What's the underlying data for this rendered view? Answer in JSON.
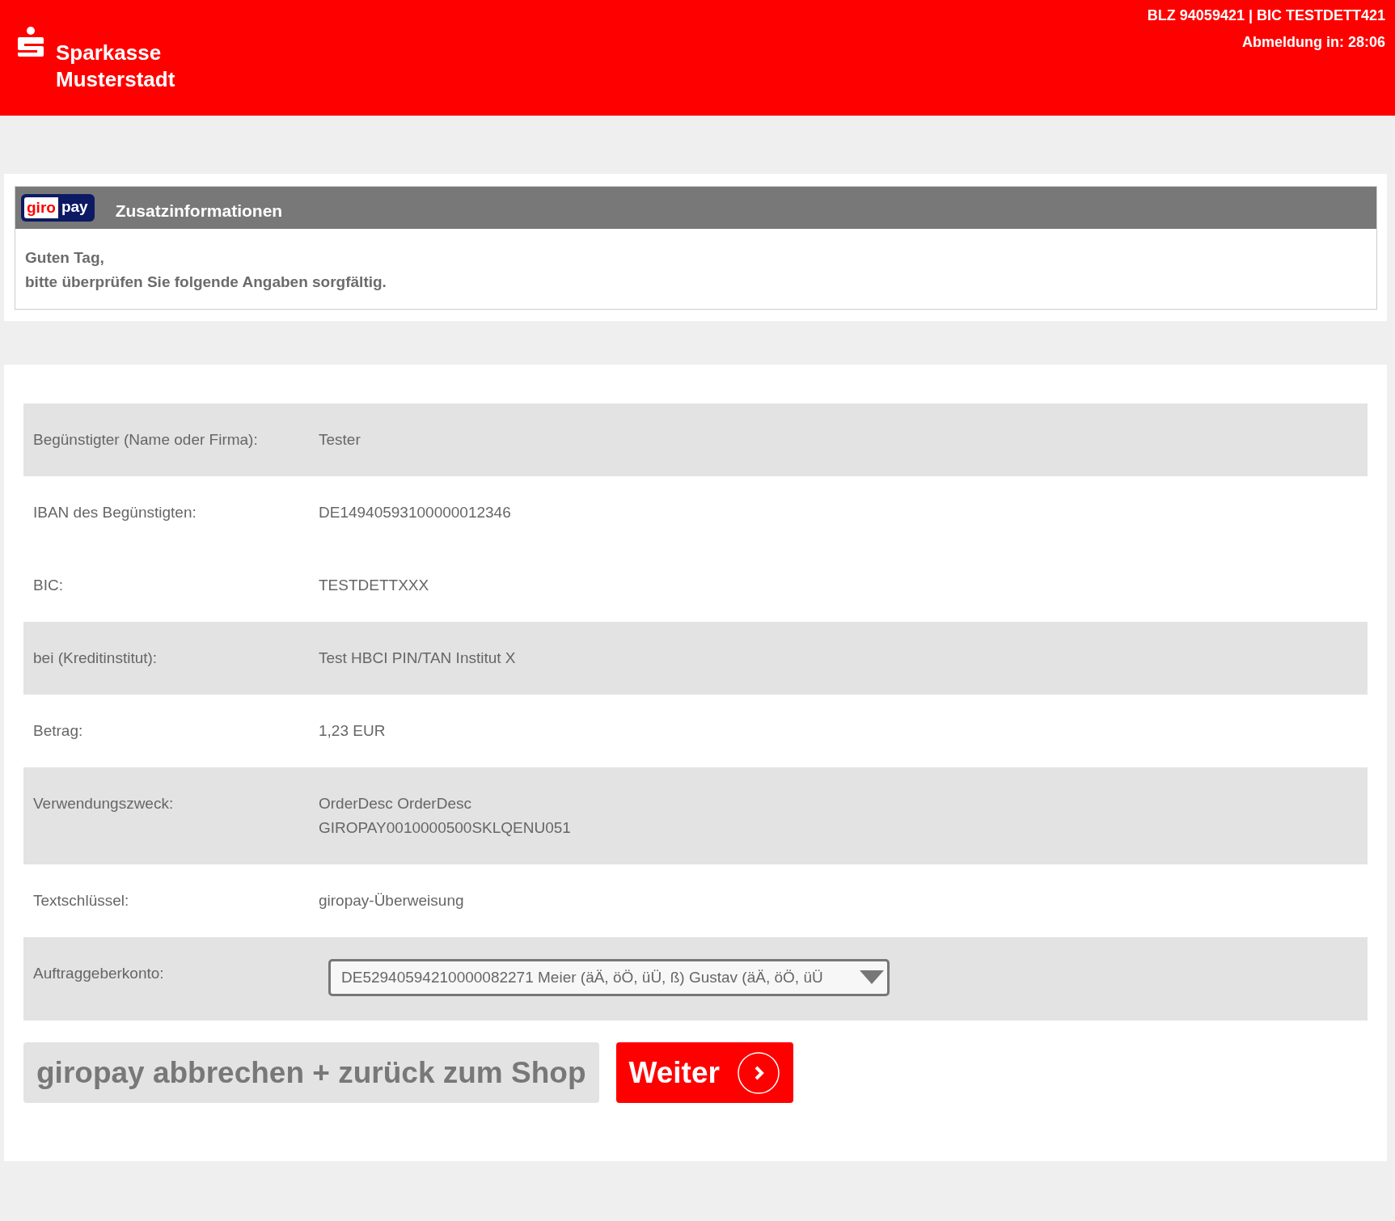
{
  "header": {
    "bank_name_lines": [
      "Sparkasse",
      "Musterstadt"
    ],
    "bank_ids": "BLZ 94059421 | BIC TESTDETT421",
    "logout_timer": "Abmeldung in: 28:06"
  },
  "info_panel": {
    "logo": {
      "part_1": "giro",
      "part_2": "pay"
    },
    "title": "Zusatzinformationen",
    "greeting_lines": [
      "Guten Tag,",
      "bitte überprüfen Sie folgende Angaben sorgfältig."
    ]
  },
  "details": [
    {
      "kind": "text",
      "shaded": true,
      "label": "Begünstigter (Name oder Firma):",
      "value_lines": [
        "Tester"
      ]
    },
    {
      "kind": "text",
      "shaded": false,
      "label": "IBAN des Begünstigten:",
      "value_lines": [
        "DE14940593100000012346"
      ]
    },
    {
      "kind": "text",
      "shaded": false,
      "label": "BIC:",
      "value_lines": [
        "TESTDETTXXX"
      ]
    },
    {
      "kind": "text",
      "shaded": true,
      "label": "bei (Kreditinstitut):",
      "value_lines": [
        "Test HBCI PIN/TAN Institut X"
      ]
    },
    {
      "kind": "text",
      "shaded": false,
      "label": "Betrag:",
      "value_lines": [
        "1,23 EUR"
      ]
    },
    {
      "kind": "text",
      "shaded": true,
      "label": "Verwendungszweck:",
      "value_lines": [
        "OrderDesc OrderDesc",
        "GIROPAY0010000500SKLQENU051"
      ]
    },
    {
      "kind": "text",
      "shaded": false,
      "label": "Textschlüssel:",
      "value_lines": [
        "giropay-Überweisung"
      ]
    },
    {
      "kind": "select",
      "shaded": true,
      "label": "Auftraggeberkonto:",
      "value_lines": [
        "DE52940594210000082271 Meier (äÄ, öÖ, üÜ, ß) Gustav (äÄ, öÖ, üÜ"
      ]
    }
  ],
  "buttons": [
    {
      "kind": "secondary",
      "label": "giropay abbrechen + zurück zum Shop"
    },
    {
      "kind": "primary",
      "label": "Weiter"
    }
  ]
}
